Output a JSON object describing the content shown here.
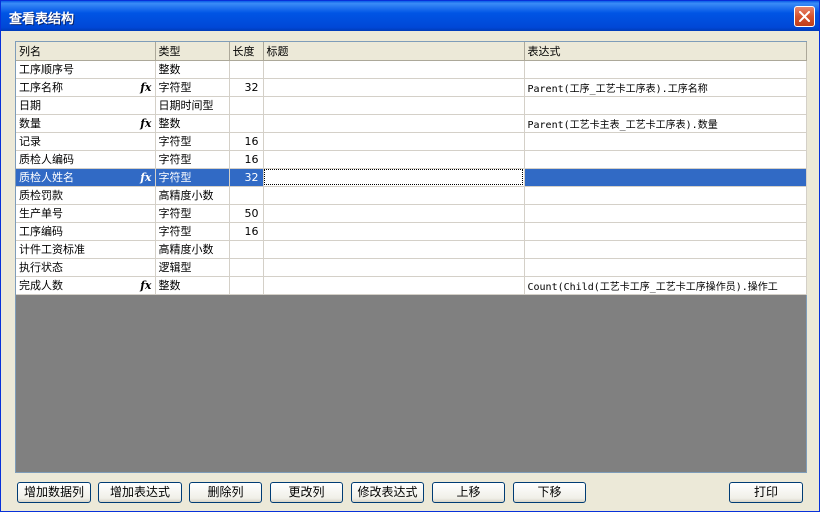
{
  "window": {
    "title": "查看表结构"
  },
  "grid": {
    "headers": [
      "列名",
      "类型",
      "长度",
      "标题",
      "表达式"
    ],
    "rows": [
      {
        "name": "工序顺序号",
        "fx": false,
        "type": "整数",
        "length": "",
        "caption": "",
        "expr": ""
      },
      {
        "name": "工序名称",
        "fx": true,
        "type": "字符型",
        "length": "32",
        "caption": "",
        "expr": "Parent(工序_工艺卡工序表).工序名称"
      },
      {
        "name": "日期",
        "fx": false,
        "type": "日期时间型",
        "length": "",
        "caption": "",
        "expr": ""
      },
      {
        "name": "数量",
        "fx": true,
        "type": "整数",
        "length": "",
        "caption": "",
        "expr": "Parent(工艺卡主表_工艺卡工序表).数量"
      },
      {
        "name": "记录",
        "fx": false,
        "type": "字符型",
        "length": "16",
        "caption": "",
        "expr": ""
      },
      {
        "name": "质检人编码",
        "fx": false,
        "type": "字符型",
        "length": "16",
        "caption": "",
        "expr": ""
      },
      {
        "name": "质检人姓名",
        "fx": true,
        "type": "字符型",
        "length": "32",
        "caption": "",
        "expr": "",
        "selected": true
      },
      {
        "name": "质检罚款",
        "fx": false,
        "type": "高精度小数",
        "length": "",
        "caption": "",
        "expr": ""
      },
      {
        "name": "生产单号",
        "fx": false,
        "type": "字符型",
        "length": "50",
        "caption": "",
        "expr": ""
      },
      {
        "name": "工序编码",
        "fx": false,
        "type": "字符型",
        "length": "16",
        "caption": "",
        "expr": ""
      },
      {
        "name": "计件工资标准",
        "fx": false,
        "type": "高精度小数",
        "length": "",
        "caption": "",
        "expr": ""
      },
      {
        "name": "执行状态",
        "fx": false,
        "type": "逻辑型",
        "length": "",
        "caption": "",
        "expr": ""
      },
      {
        "name": "完成人数",
        "fx": true,
        "type": "整数",
        "length": "",
        "caption": "",
        "expr": "Count(Child(工艺卡工序_工艺卡工序操作员).操作工"
      }
    ],
    "fx_symbol": "fx"
  },
  "buttons": {
    "add_data_column": "增加数据列",
    "add_expression": "增加表达式",
    "delete_column": "删除列",
    "change_column": "更改列",
    "modify_expression": "修改表达式",
    "move_up": "上移",
    "move_down": "下移",
    "print": "打印"
  },
  "colors": {
    "titlebar": "#0055e5",
    "selection": "#316ac5",
    "grid_background": "#808080"
  },
  "icons": {
    "close": "close-icon",
    "formula": "fx-icon"
  }
}
